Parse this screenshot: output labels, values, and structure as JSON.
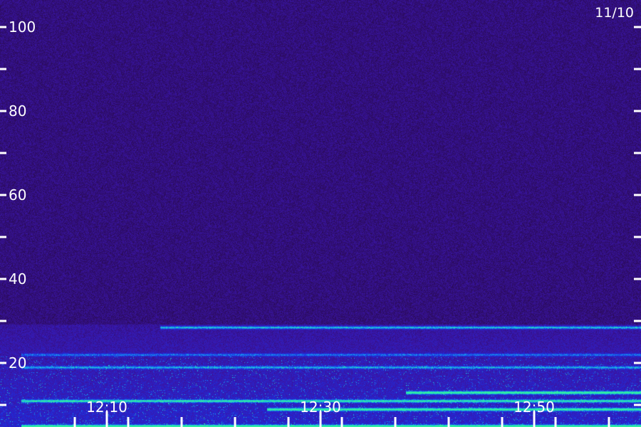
{
  "date_label": "11/10",
  "chart_data": {
    "type": "heatmap",
    "title": "",
    "xlabel": "",
    "ylabel": "",
    "x_tick_labels": [
      "12:10",
      "12:30",
      "12:50"
    ],
    "y_tick_labels": [
      "20",
      "40",
      "60",
      "80",
      "100"
    ],
    "ylim": [
      0,
      102
    ],
    "xlim": [
      "12:02",
      "13:02"
    ],
    "colormap": [
      "#2a0a55",
      "#3a16a8",
      "#1c2ee0",
      "#18a8f0",
      "#30f0a0"
    ],
    "bands": [
      {
        "y": 28.5,
        "x_start": "12:15",
        "x_end": "13:02",
        "intensity": 0.65
      },
      {
        "y": 22,
        "x_start": "12:02",
        "x_end": "13:02",
        "intensity": 0.4
      },
      {
        "y": 19,
        "x_start": "12:02",
        "x_end": "13:02",
        "intensity": 0.5
      },
      {
        "y": 13,
        "x_start": "12:38",
        "x_end": "13:02",
        "intensity": 0.9
      },
      {
        "y": 11,
        "x_start": "12:02",
        "x_end": "13:02",
        "intensity": 0.7
      },
      {
        "y": 9,
        "x_start": "12:25",
        "x_end": "13:02",
        "intensity": 0.8
      },
      {
        "y": 5,
        "x_start": "12:02",
        "x_end": "13:02",
        "intensity": 0.85
      }
    ]
  }
}
